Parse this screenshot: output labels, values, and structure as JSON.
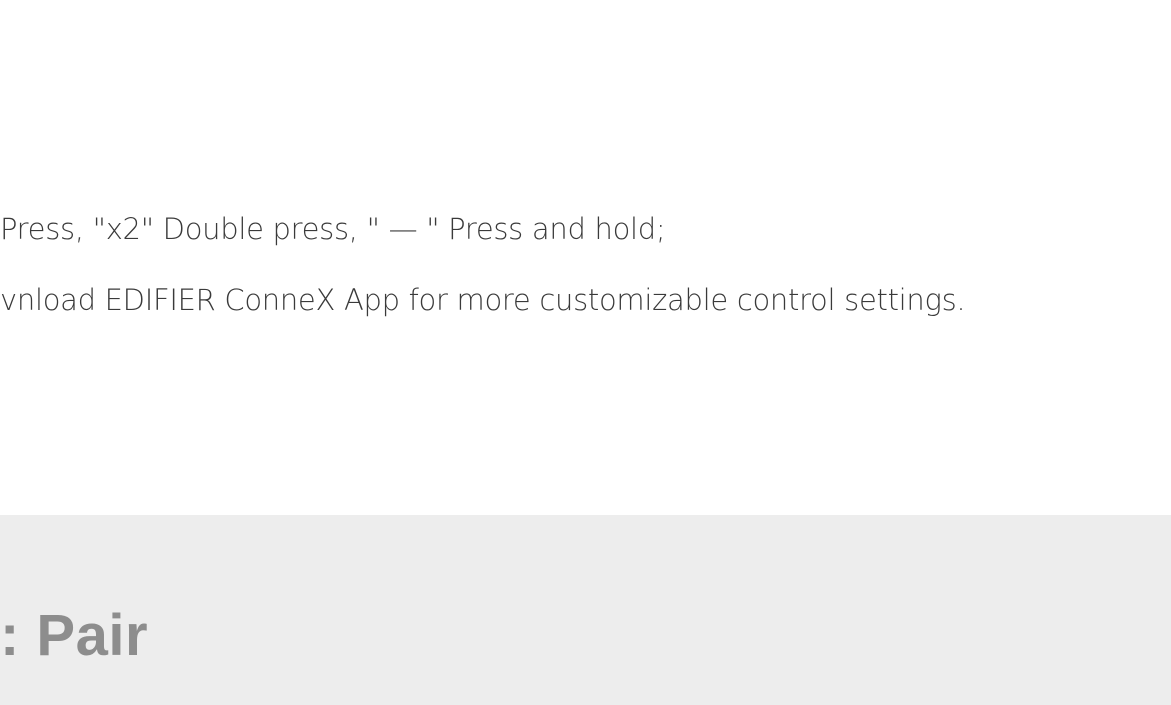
{
  "notes": {
    "line1": "Press, \"x2\" Double press, \" — \" Press and hold;",
    "line2": "vnload EDIFIER ConneX App for more customizable control settings."
  },
  "pair_section": {
    "title": ": Pair"
  },
  "colors": {
    "text": "#3a3a3a",
    "section_bg": "#ededed",
    "section_title": "#8d8d8d"
  }
}
